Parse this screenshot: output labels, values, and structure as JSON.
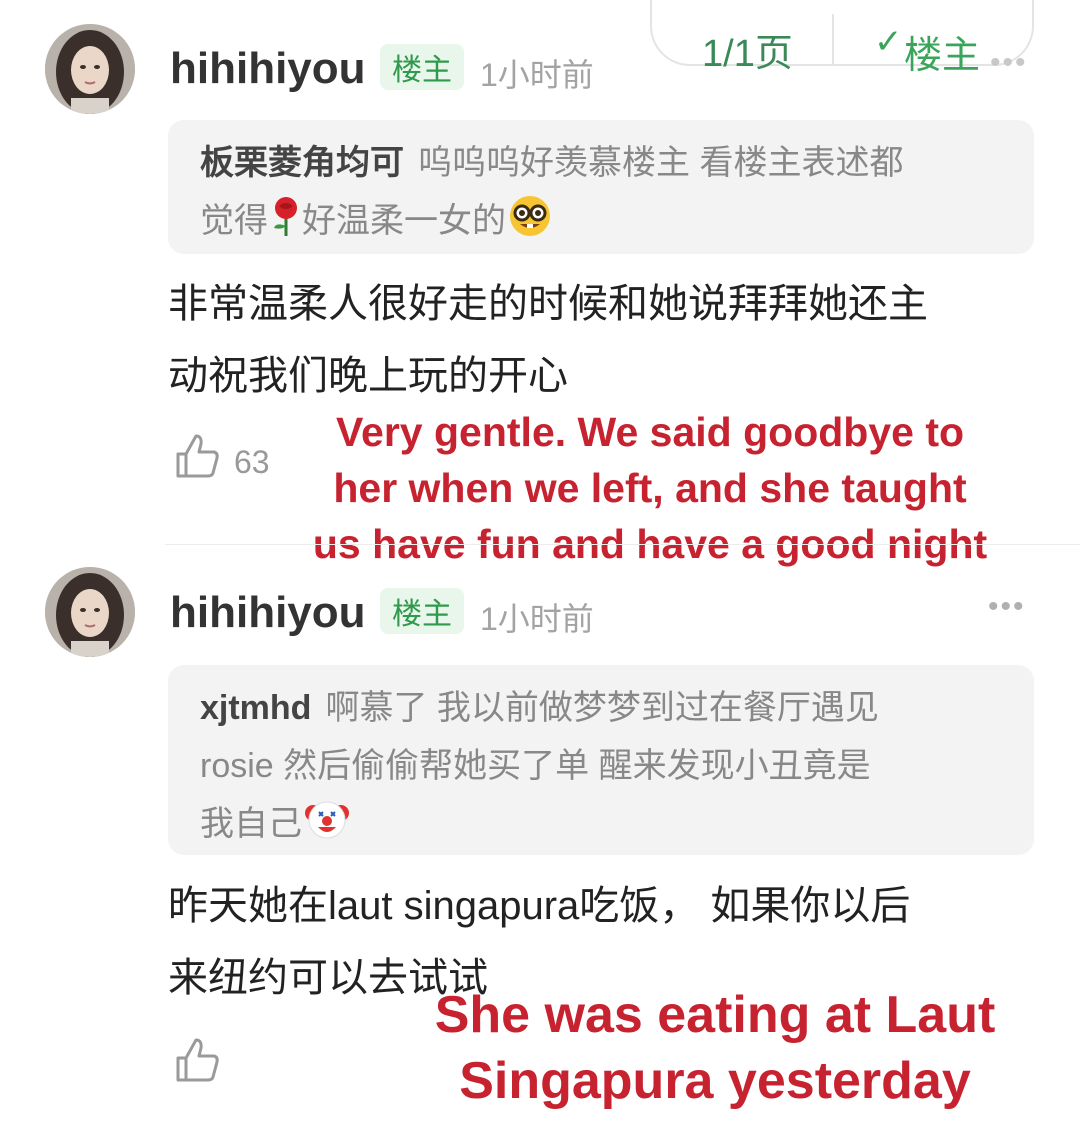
{
  "pager": {
    "page": "1/1页",
    "check_icon": "check-icon",
    "filter_label": "楼主"
  },
  "comments": [
    {
      "username": "hihihiyou",
      "badge": "楼主",
      "time": "1小时前",
      "quote": {
        "name": "板栗菱角均可",
        "text_a": "呜呜呜好羡慕楼主 看楼主表述都",
        "text_b": "觉得",
        "text_c": "好温柔一女的",
        "emojis": [
          "rose-emoji",
          "nerd-face-emoji"
        ]
      },
      "body": [
        "非常温柔人很好走的时候和她说拜拜她还主",
        "动祝我们晚上玩的开心"
      ],
      "likes": "63"
    },
    {
      "username": "hihihiyou",
      "badge": "楼主",
      "time": "1小时前",
      "quote": {
        "name": "xjtmhd",
        "line1": "啊慕了 我以前做梦梦到过在餐厅遇见",
        "line2": "rosie 然后偷偷帮她买了单 醒来发现小丑竟是",
        "line3": "我自己",
        "emojis": [
          "clown-face-emoji"
        ]
      },
      "body": [
        "昨天她在laut singapura吃饭， 如果你以后",
        "来纽约可以去试试"
      ],
      "likes": ""
    }
  ],
  "overlays": {
    "translation_1": [
      "Very gentle. We said goodbye to",
      "her when we left, and she taught",
      "us have fun and have a good night"
    ],
    "translation_2": [
      "She was eating at Laut",
      "Singapura yesterday"
    ]
  },
  "colors": {
    "accent_green": "#2f9a4c",
    "badge_bg": "#e8f6ec",
    "overlay_red": "#c72230"
  }
}
